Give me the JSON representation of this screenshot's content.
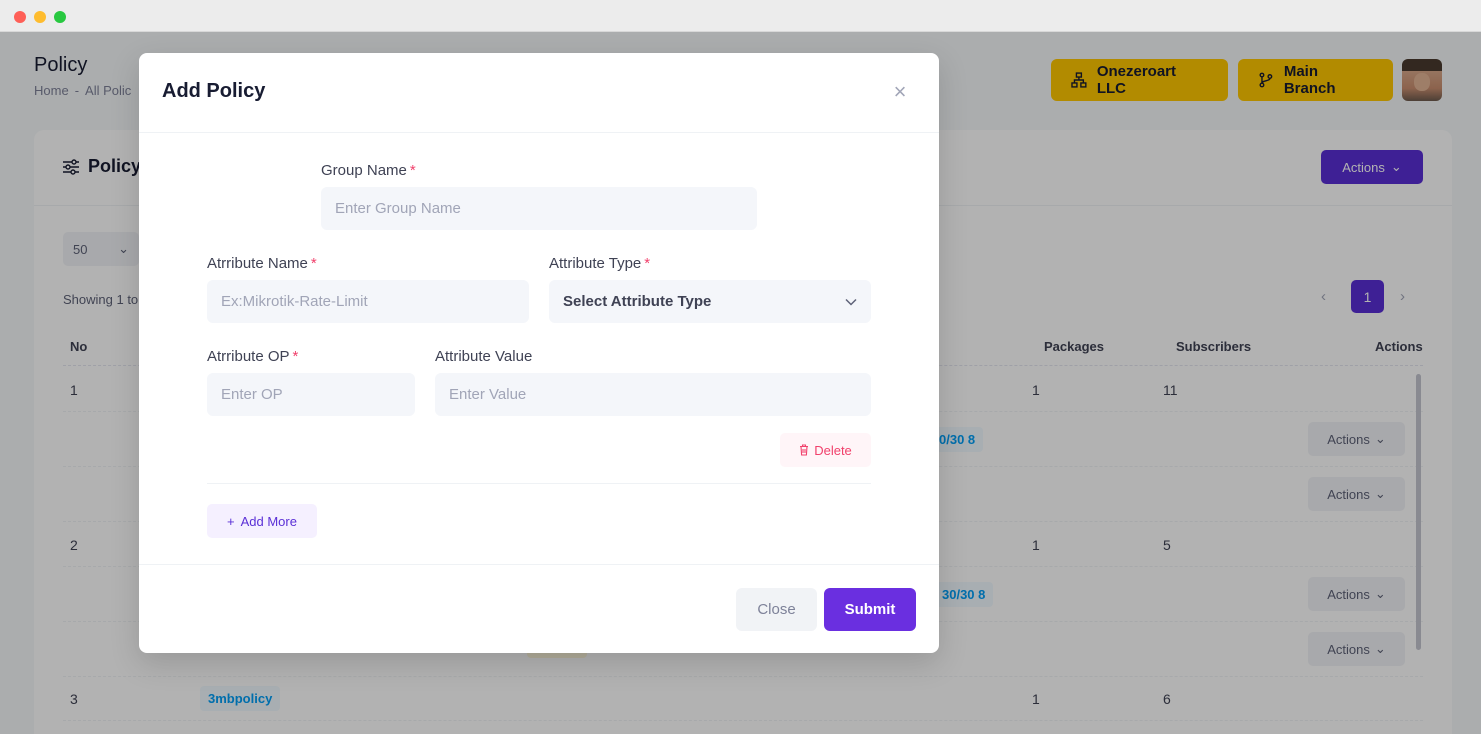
{
  "window": {
    "colors": {
      "close": "#fe5f57",
      "minimize": "#febc2e",
      "maximize": "#28c840"
    }
  },
  "page": {
    "title": "Policy",
    "breadcrumb": [
      "Home",
      "-",
      "All Polic"
    ],
    "company_button": {
      "label": "Onezeroart LLC",
      "icon": "sitemap-icon"
    },
    "branch_button": {
      "label": "Main Branch",
      "icon": "git-branch-icon"
    },
    "colors": {
      "accent": "#5a2fd6",
      "warning": "#ffc700"
    }
  },
  "card": {
    "title": "Policy",
    "actions_label": "Actions",
    "per_page": "50",
    "showing_text": "Showing 1 to",
    "pagination": {
      "current": "1"
    },
    "columns": [
      "No",
      "Packages",
      "Subscribers",
      "Actions"
    ],
    "rows": [
      {
        "no": "1",
        "packages": "1",
        "subscribers": "11",
        "badge": "0/30 8",
        "action_labels": [
          "Actions",
          "Actions"
        ]
      },
      {
        "no": "2",
        "packages": "1",
        "subscribers": "5",
        "badge": "30/30 8",
        "action_labels": [
          "Actions",
          "Actions"
        ]
      },
      {
        "no": "3",
        "name": "3mbpolicy",
        "packages": "1",
        "subscribers": "6"
      }
    ]
  },
  "modal": {
    "title": "Add Policy",
    "group_name": {
      "label": "Group Name",
      "placeholder": "Enter Group Name",
      "required": "*"
    },
    "attribute_name": {
      "label": "Atrribute Name",
      "placeholder": "Ex:Mikrotik-Rate-Limit",
      "required": "*"
    },
    "attribute_type": {
      "label": "Attribute Type",
      "value": "Select Attribute Type",
      "required": "*"
    },
    "attribute_op": {
      "label": "Atrribute OP",
      "placeholder": "Enter OP",
      "required": "*"
    },
    "attribute_value": {
      "label": "Attribute Value",
      "placeholder": "Enter Value"
    },
    "delete_label": "Delete",
    "add_more_label": "Add More",
    "close_label": "Close",
    "submit_label": "Submit",
    "colors": {
      "danger": "#f1416c",
      "primary": "#6a2fe0"
    }
  }
}
